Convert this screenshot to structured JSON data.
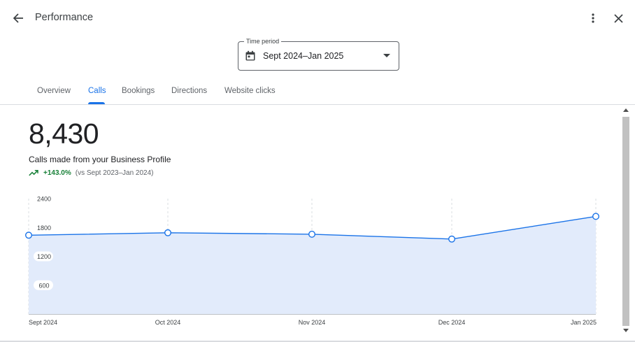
{
  "header": {
    "title": "Performance",
    "icons": {
      "back": "arrow-back-icon",
      "more": "more-vert-icon",
      "close": "close-icon"
    }
  },
  "time_period": {
    "legend": "Time period",
    "value": "Sept 2024–Jan 2025",
    "icon": "calendar-icon"
  },
  "tabs": [
    {
      "label": "Overview",
      "active": false
    },
    {
      "label": "Calls",
      "active": true
    },
    {
      "label": "Bookings",
      "active": false
    },
    {
      "label": "Directions",
      "active": false
    },
    {
      "label": "Website clicks",
      "active": false
    }
  ],
  "summary": {
    "total": "8,430",
    "label": "Calls made from your Business Profile",
    "change": "+143.0%",
    "comparison": "(vs Sept 2023–Jan 2024)",
    "trend_icon": "trending-up-icon"
  },
  "colors": {
    "accent": "#1a73e8",
    "line": "#1a73e8",
    "area": "#e2ebfb",
    "positive": "#188038"
  },
  "chart_data": {
    "type": "area",
    "x": [
      "Sept 2024",
      "Oct 2024",
      "Nov 2024",
      "Dec 2024",
      "Jan 2025"
    ],
    "series": [
      {
        "values": [
          1640,
          1690,
          1660,
          1560,
          2030
        ]
      }
    ],
    "y_ticks": [
      "2400",
      "1800",
      "1200",
      "600"
    ],
    "ylim": [
      0,
      2400
    ],
    "grid": "vertical dashed",
    "markers": "hollow circles"
  }
}
